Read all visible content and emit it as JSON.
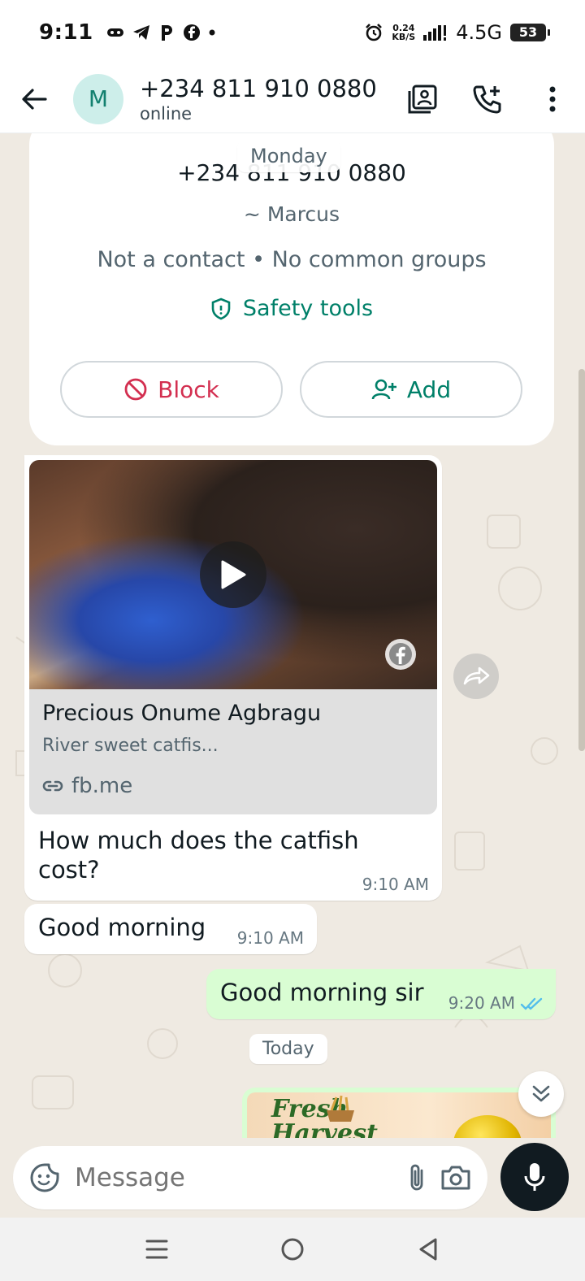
{
  "status_bar": {
    "time": "9:11",
    "net_speed_value": "0.24",
    "net_speed_unit": "KB/S",
    "network": "4.5G",
    "battery": "53"
  },
  "header": {
    "avatar_initial": "M",
    "contact_name": "+234 811 910 0880",
    "contact_status": "online"
  },
  "profile_card": {
    "phone": "+234 811 910 0880",
    "alias": "~ Marcus",
    "meta": "Not a contact • No common groups",
    "safety_tools": "Safety tools",
    "block_label": "Block",
    "add_label": "Add"
  },
  "dates": {
    "monday": "Monday",
    "today": "Today"
  },
  "messages": {
    "link_message": {
      "preview_title": "Precious Onume Agbragu",
      "preview_desc": "River sweet catfis...",
      "preview_url": "fb.me",
      "text": "How much does the catfish cost?",
      "time": "9:10 AM"
    },
    "good_morning": {
      "text": "Good morning",
      "time": "9:10 AM"
    },
    "outgoing": {
      "text": "Good morning sir",
      "time": "9:20 AM"
    },
    "harvest_image": {
      "title_line1": "Fresh",
      "title_line2": "Harvest"
    }
  },
  "input": {
    "placeholder": "Message"
  },
  "colors": {
    "accent": "#008069",
    "block_red": "#d32f50",
    "chat_bg": "#efeae2",
    "outgoing_bubble": "#d9fdd3",
    "read_ticks": "#53bdeb"
  }
}
